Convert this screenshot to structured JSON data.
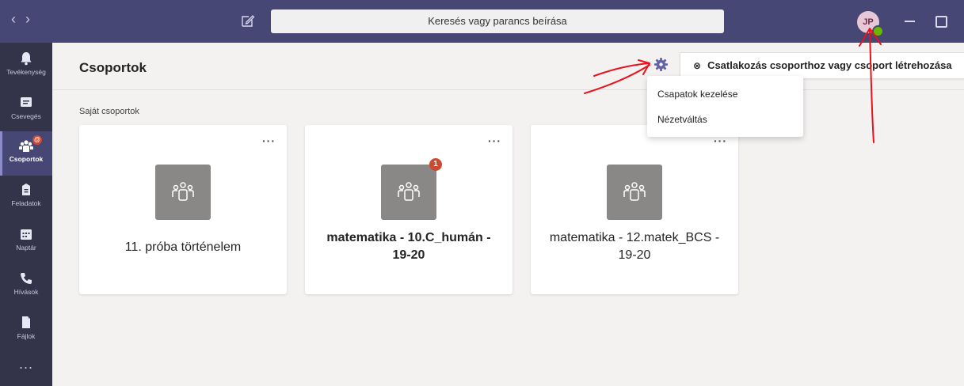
{
  "topbar": {
    "search_placeholder": "Keresés vagy parancs beírása",
    "avatar_initials": "JP",
    "presence_status": "available"
  },
  "rail": {
    "items": [
      {
        "label": "Tevékenység",
        "icon": "bell-icon"
      },
      {
        "label": "Csevegés",
        "icon": "chat-icon"
      },
      {
        "label": "Csoportok",
        "icon": "teams-icon",
        "active": true,
        "badge": "@"
      },
      {
        "label": "Feladatok",
        "icon": "assignments-icon"
      },
      {
        "label": "Naptár",
        "icon": "calendar-icon"
      },
      {
        "label": "Hívások",
        "icon": "phone-icon"
      },
      {
        "label": "Fájlok",
        "icon": "file-icon"
      }
    ],
    "more_label": "..."
  },
  "header": {
    "title": "Csoportok",
    "join_button_label": "Csatlakozás csoporthoz vagy csoport létrehozása"
  },
  "menu": {
    "items": [
      "Csapatok kezelése",
      "Nézetváltás"
    ]
  },
  "section": {
    "title": "Saját csoportok"
  },
  "teams": [
    {
      "name": "11. próba történelem",
      "bold": false,
      "badge": ""
    },
    {
      "name": "matematika - 10.C_humán - 19-20",
      "bold": true,
      "badge": "1"
    },
    {
      "name": "matematika - 12.matek_BCS - 19-20",
      "bold": false,
      "badge": ""
    }
  ],
  "colors": {
    "topbar": "#464775",
    "rail": "#33344a",
    "badge": "#cc4a31",
    "annotation": "#e8121c",
    "gear": "#6264a7"
  }
}
